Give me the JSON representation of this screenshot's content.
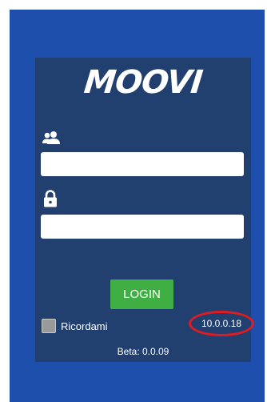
{
  "brand": {
    "logo_text": "MOOVI"
  },
  "form": {
    "username_icon": "users-icon",
    "username_value": "",
    "password_icon": "lock-icon",
    "password_value": "",
    "login_label": "LOGIN",
    "remember_label": "Ricordami",
    "remember_checked": false
  },
  "footer": {
    "version": "10.0.0.18",
    "beta": "Beta: 0.0.09"
  },
  "colors": {
    "screen_background": "#1f4fac",
    "card_background": "#22406f",
    "login_button": "#3fae43",
    "highlight_circle": "#e11b22"
  }
}
